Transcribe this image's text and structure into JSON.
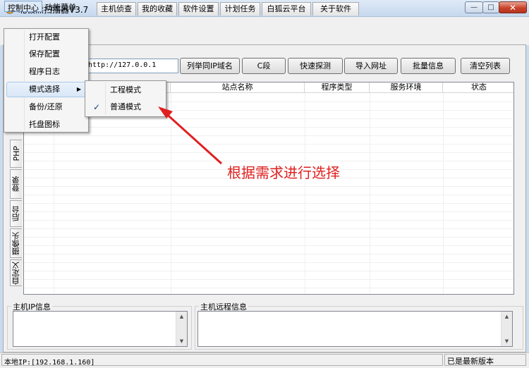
{
  "window": {
    "title": "北极熊扫描器V3.7",
    "minimize_glyph": "—",
    "maximize_glyph": "□",
    "close_glyph": "✕"
  },
  "menubar": {
    "items": [
      "控制中心",
      "功能菜单"
    ]
  },
  "tabs": [
    "主机侦查",
    "我的收藏",
    "软件设置",
    "计划任务",
    "白狐云平台",
    "关于软件"
  ],
  "toolbar": {
    "target_value": "http://127.0.0.1",
    "buttons": [
      "列举同IP域名",
      "C段",
      "快速探测",
      "导入网址",
      "批量信息",
      "清空列表"
    ]
  },
  "grid": {
    "columns": [
      "站点名称",
      "程序类型",
      "服务环境",
      "状态"
    ]
  },
  "side_tabs": [
    "PHP",
    "登录",
    "后台",
    "摄像头",
    "自定义"
  ],
  "control_menu": {
    "items": [
      "打开配置",
      "保存配置",
      "程序日志",
      "模式选择",
      "备份/还原",
      "托盘图标"
    ],
    "submenu_arrow": "▶"
  },
  "mode_submenu": {
    "items": [
      "工程模式",
      "普通模式"
    ],
    "checked_index": 1,
    "check_glyph": "✓"
  },
  "panels": {
    "ip_info_title": "主机IP信息",
    "process_info_title": "主机远程信息",
    "scroll_up": "▲",
    "scroll_down": "▼"
  },
  "status": {
    "local_ip": "本地IP:[192.168.1.160]",
    "version_status": "已是最新版本"
  },
  "annotation": {
    "text": "根据需求进行选择",
    "color": "#e02020"
  }
}
